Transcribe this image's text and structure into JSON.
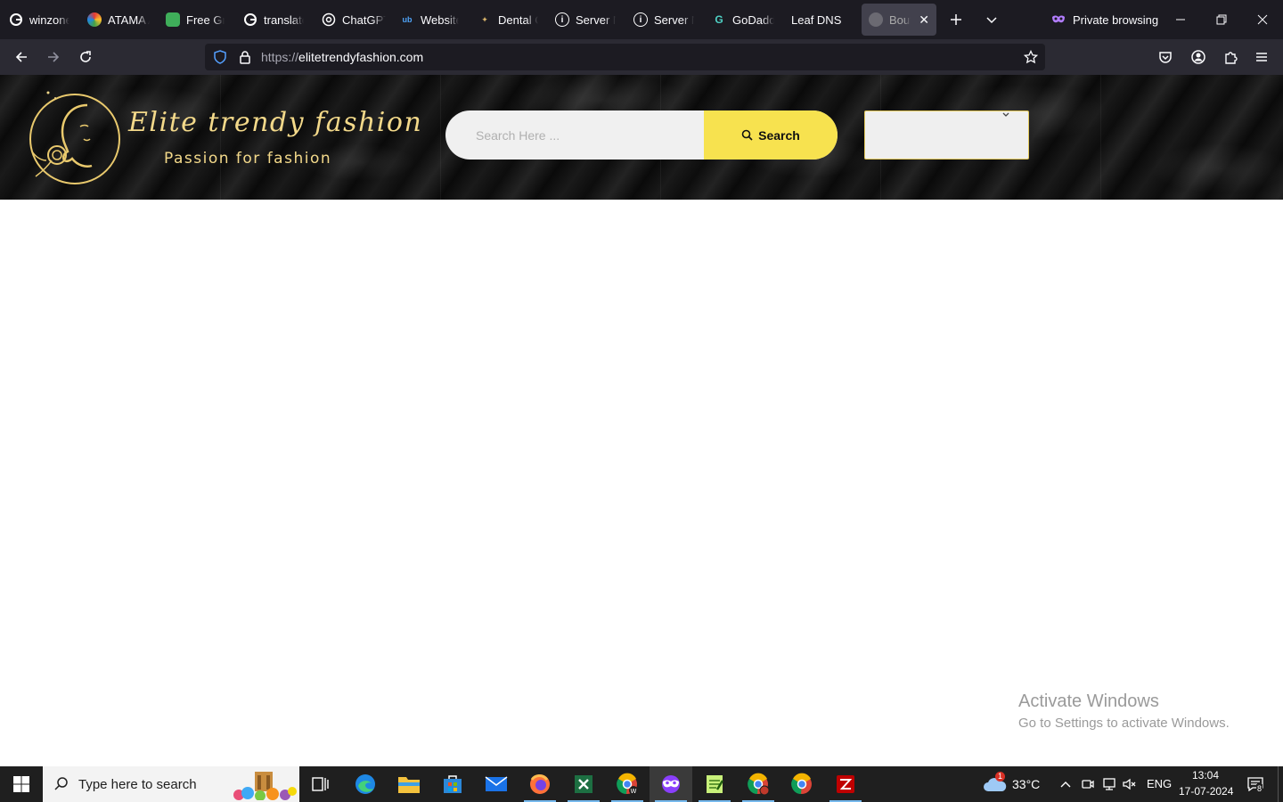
{
  "browser": {
    "tabs": [
      {
        "label": "winzone",
        "favicon": "google-g-icon"
      },
      {
        "label": "ATAMA A",
        "favicon": "colorful-circle-icon"
      },
      {
        "label": "Free Gra",
        "favicon": "green-shield-icon"
      },
      {
        "label": "translate",
        "favicon": "google-g-icon"
      },
      {
        "label": "ChatGPT",
        "favicon": "openai-icon"
      },
      {
        "label": "Website",
        "favicon": "ub-logo-icon"
      },
      {
        "label": "Dental C",
        "favicon": "tooth-logo-icon"
      },
      {
        "label": "Server N",
        "favicon": "info-icon"
      },
      {
        "label": "Server N",
        "favicon": "info-icon"
      },
      {
        "label": "GoDaddy",
        "favicon": "godaddy-icon"
      },
      {
        "label": "Leaf DNS",
        "favicon": "none"
      },
      {
        "label": "Boutiq",
        "favicon": "boutique-logo-icon",
        "active": true
      }
    ],
    "private_label": "Private browsing",
    "url": {
      "scheme": "https://",
      "host": "elitetrendyfashion.com"
    }
  },
  "site": {
    "brand_title": "Elite trendy fashion",
    "brand_tagline": "Passion for fashion",
    "search": {
      "placeholder": "Search Here ...",
      "button_label": "Search"
    },
    "category_select": {
      "selected": ""
    },
    "colors": {
      "gold": "#f3d98a",
      "search_button": "#f7e24f",
      "header_bg": "#111111"
    }
  },
  "watermark": {
    "title": "Activate Windows",
    "subtitle": "Go to Settings to activate Windows."
  },
  "taskbar": {
    "search_placeholder": "Type here to search",
    "apps": [
      "task-view-icon",
      "edge-icon",
      "file-explorer-icon",
      "store-icon",
      "mail-icon",
      "firefox-icon",
      "excel-icon",
      "chrome-w-icon",
      "firefox-private-icon",
      "notepad-plus-icon",
      "chrome-profile-icon",
      "chrome-icon",
      "filezilla-icon"
    ],
    "weather": {
      "temp": "33°C",
      "badge": "1"
    },
    "language": "ENG",
    "time": "13:04",
    "date": "17-07-2024",
    "notification_count": "8"
  }
}
